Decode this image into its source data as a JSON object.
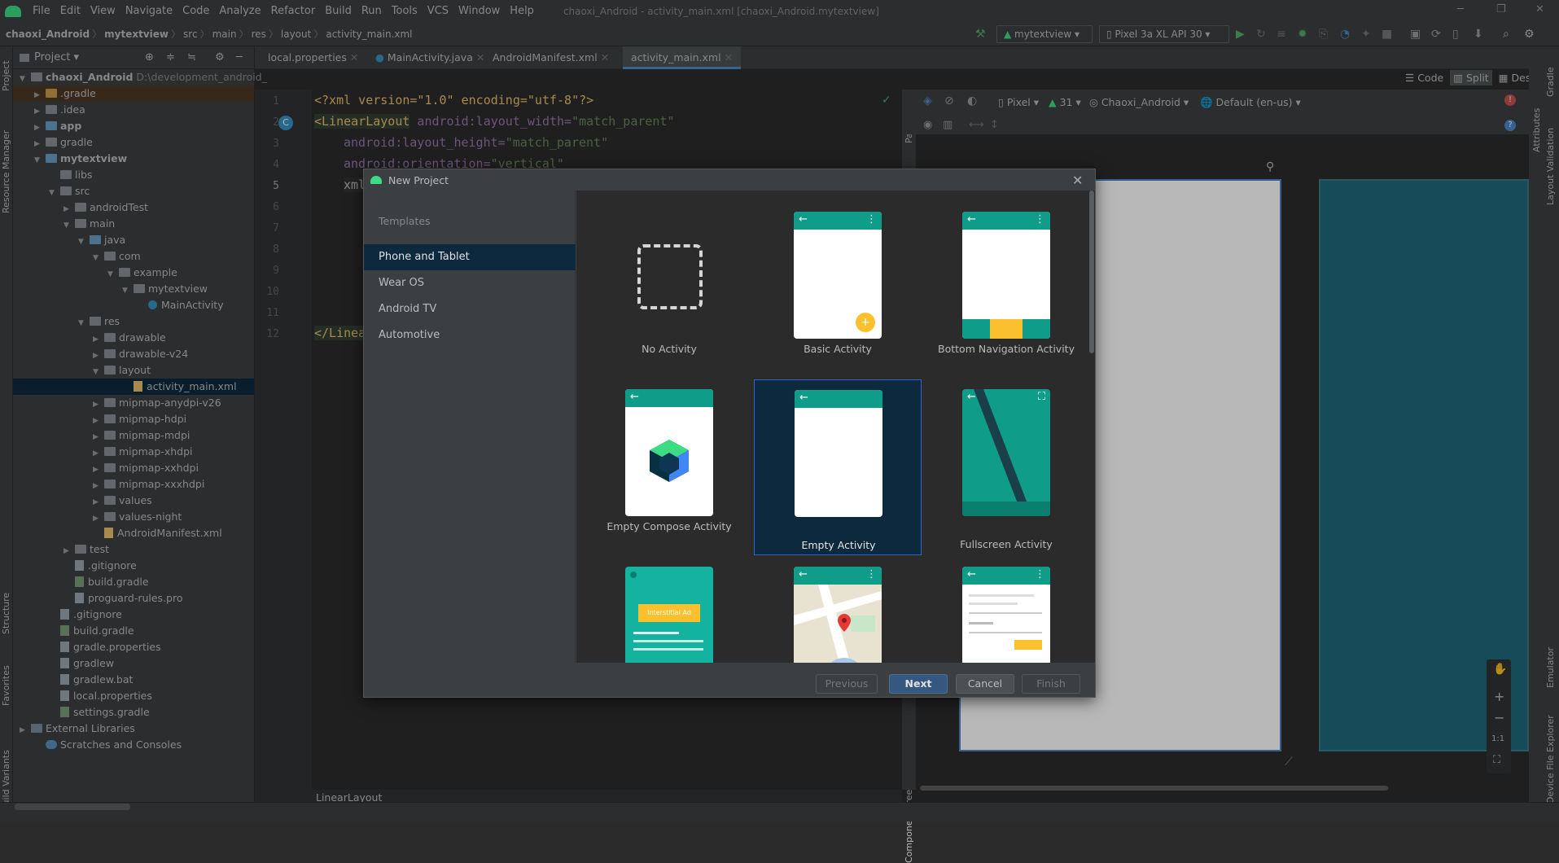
{
  "menubar": {
    "items": [
      "File",
      "Edit",
      "View",
      "Navigate",
      "Code",
      "Analyze",
      "Refactor",
      "Build",
      "Run",
      "Tools",
      "VCS",
      "Window",
      "Help"
    ],
    "title": "chaoxi_Android - activity_main.xml [chaoxi_Android.mytextview]"
  },
  "navbar": {
    "crumbs": [
      "chaoxi_Android",
      "mytextview",
      "src",
      "main",
      "res",
      "layout",
      "activity_main.xml"
    ],
    "run_config": "mytextview",
    "device": "Pixel 3a XL API 30"
  },
  "project_panel": {
    "title": "Project",
    "root_path": "D:\\development_android_",
    "tree": [
      "chaoxi_Android",
      ".gradle",
      ".idea",
      "app",
      "gradle",
      "mytextview",
      "libs",
      "src",
      "androidTest",
      "main",
      "java",
      "com",
      "example",
      "mytextview",
      "MainActivity",
      "res",
      "drawable",
      "drawable-v24",
      "layout",
      "activity_main.xml",
      "mipmap-anydpi-v26",
      "mipmap-hdpi",
      "mipmap-mdpi",
      "mipmap-xhdpi",
      "mipmap-xxhdpi",
      "mipmap-xxxhdpi",
      "values",
      "values-night",
      "AndroidManifest.xml",
      "test",
      ".gitignore",
      "build.gradle",
      "proguard-rules.pro",
      ".gitignore",
      "build.gradle",
      "gradle.properties",
      "gradlew",
      "gradlew.bat",
      "local.properties",
      "settings.gradle",
      "External Libraries",
      "Scratches and Consoles"
    ]
  },
  "left_strip": [
    "Project",
    "Resource Manager",
    "Structure",
    "Favorites",
    "Build Variants"
  ],
  "right_strip": [
    "Gradle",
    "Layout Validation",
    "Attributes",
    "Emulator",
    "Device File Explorer"
  ],
  "tabs": [
    "local.properties",
    "MainActivity.java",
    "AndroidManifest.xml",
    "activity_main.xml"
  ],
  "editor": {
    "line_numbers": [
      "1",
      "2",
      "3",
      "4",
      "5",
      "6",
      "7",
      "8",
      "9",
      "10",
      "11",
      "12"
    ],
    "l1": "<?xml version=\"1.0\" encoding=\"utf-8\"?>",
    "l2_tag": "<LinearLayout",
    "l2_attr": " android:layout_width=",
    "l2_val": "\"match_parent\"",
    "l3_attr": "android:layout_height=",
    "l3_val": "\"match_parent\"",
    "l4_attr": "android:orientation=",
    "l4_val": "\"vertical\"",
    "l5": "xml",
    "l12": "</Linea",
    "breadcrumb": "LinearLayout"
  },
  "design": {
    "view_modes": [
      "Code",
      "Split",
      "Design"
    ],
    "device": "Pixel",
    "api": "31",
    "theme": "Chaoxi_Android",
    "locale": "Default (en-us)",
    "palette": "Palette",
    "component_tree": "Component Tree",
    "zoom_ratio": "1:1"
  },
  "dialog": {
    "title": "New Project",
    "templates_heading": "Templates",
    "categories": [
      "Phone and Tablet",
      "Wear OS",
      "Android TV",
      "Automotive"
    ],
    "templates": [
      "No Activity",
      "Basic Activity",
      "Bottom Navigation Activity",
      "Empty Compose Activity",
      "Empty Activity",
      "Fullscreen Activity"
    ],
    "ad_label": "Interstitial Ad",
    "buttons": {
      "previous": "Previous",
      "next": "Next",
      "cancel": "Cancel",
      "finish": "Finish"
    }
  },
  "colors": {
    "accent": "#4a88c7",
    "teal": "#0f9d8a",
    "selection": "#0d293e",
    "android_green": "#3ddc84"
  }
}
